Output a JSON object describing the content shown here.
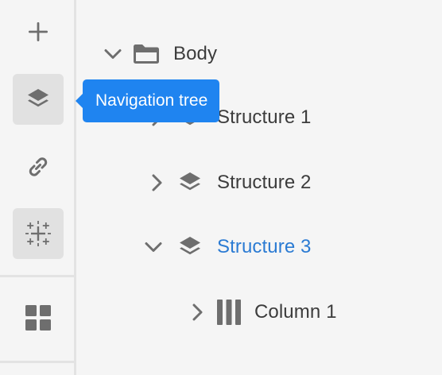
{
  "rail": {
    "items": [
      {
        "name": "add",
        "icon": "plus-icon",
        "selected": false
      },
      {
        "name": "navigation-tree",
        "icon": "layers-icon",
        "selected": true
      },
      {
        "name": "links",
        "icon": "link-icon",
        "selected": false
      },
      {
        "name": "sparkle",
        "icon": "sparkle-grid-icon",
        "selected": true
      },
      {
        "name": "components",
        "icon": "grid-blocks-icon",
        "selected": false
      }
    ]
  },
  "tooltip": {
    "text": "Navigation tree"
  },
  "tree": {
    "nodes": [
      {
        "label": "Body",
        "icon": "folder-icon",
        "expanded": true,
        "level": 0,
        "active": false
      },
      {
        "label": "Structure 1",
        "icon": "layers-icon",
        "expanded": false,
        "level": 1,
        "active": false
      },
      {
        "label": "Structure 2",
        "icon": "layers-icon",
        "expanded": false,
        "level": 1,
        "active": false
      },
      {
        "label": "Structure 3",
        "icon": "layers-icon",
        "expanded": true,
        "level": 1,
        "active": true
      },
      {
        "label": "Column 1",
        "icon": "columns-icon",
        "expanded": false,
        "level": 2,
        "active": false
      }
    ]
  },
  "colors": {
    "background": "#f5f5f5",
    "icon": "#6e6e6e",
    "text": "#3c3c3c",
    "active_text": "#2b7bd3",
    "tooltip_bg": "#1f84f0",
    "selected_bg": "#e1e1e1"
  }
}
